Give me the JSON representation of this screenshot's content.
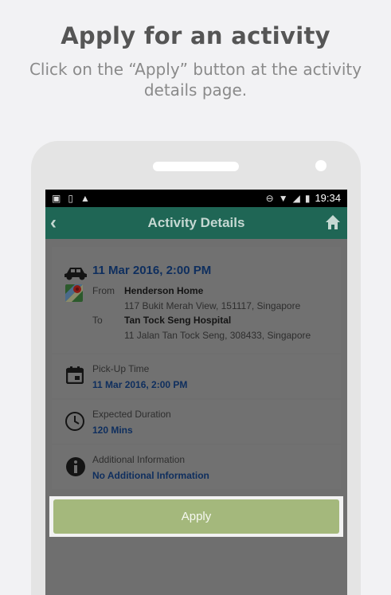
{
  "header": {
    "title": "Apply for an activity",
    "subtitle": "Click on the “Apply” button at the activity details page."
  },
  "statusbar": {
    "time": "19:34"
  },
  "appbar": {
    "title": "Activity Details"
  },
  "trip": {
    "datetime": "11 Mar 2016, 2:00 PM",
    "from_label": "From",
    "from_name": "Henderson Home",
    "from_address": "117 Bukit Merah View, 151117, Singapore",
    "to_label": "To",
    "to_name": "Tan Tock Seng Hospital",
    "to_address": "11 Jalan Tan Tock Seng, 308433, Singapore"
  },
  "pickup": {
    "label": "Pick-Up Time",
    "value": "11 Mar 2016, 2:00 PM"
  },
  "duration": {
    "label": "Expected Duration",
    "value": "120 Mins"
  },
  "info": {
    "label": "Additional Information",
    "value": "No Additional Information"
  },
  "apply_button": {
    "label": "Apply"
  },
  "colors": {
    "appbar": "#1f6655",
    "apply": "#a4b87c",
    "value_text": "#0e2e5e"
  }
}
